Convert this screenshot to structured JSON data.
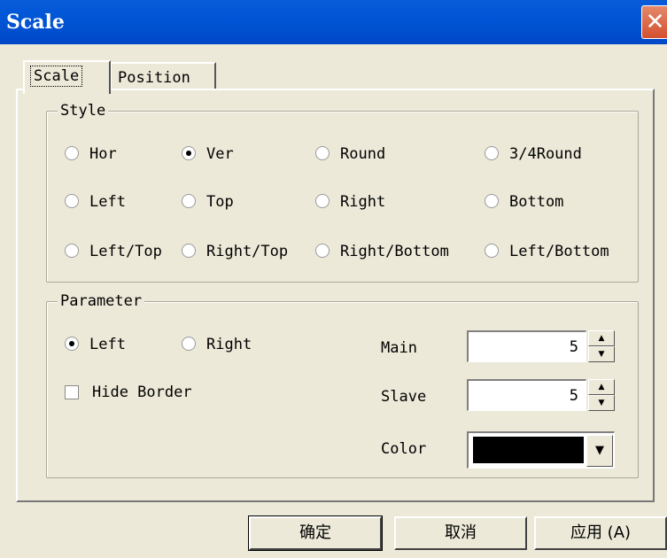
{
  "window": {
    "title": "Scale",
    "close_label": "✕"
  },
  "tabs": [
    {
      "label": "Scale",
      "active": true
    },
    {
      "label": "Position",
      "active": false
    }
  ],
  "style_group": {
    "label": "Style",
    "options": [
      "Hor",
      "Ver",
      "Round",
      "3/4Round",
      "Left",
      "Top",
      "Right",
      "Bottom",
      "Left/Top",
      "Right/Top",
      "Right/Bottom",
      "Left/Bottom"
    ],
    "selected": "Ver"
  },
  "parameter_group": {
    "label": "Parameter",
    "side_options": [
      "Left",
      "Right"
    ],
    "side_selected": "Left",
    "hide_border_label": "Hide Border",
    "hide_border_checked": false,
    "main_label": "Main",
    "main_value": "5",
    "slave_label": "Slave",
    "slave_value": "5",
    "color_label": "Color",
    "color_value": "#000000"
  },
  "buttons": {
    "ok": "确定",
    "cancel": "取消",
    "apply": "应用 (A)"
  },
  "icons": {
    "close": "close-icon",
    "spin_up": "up-arrow-icon",
    "spin_down": "down-arrow-icon",
    "dropdown": "dropdown-arrow-icon"
  }
}
